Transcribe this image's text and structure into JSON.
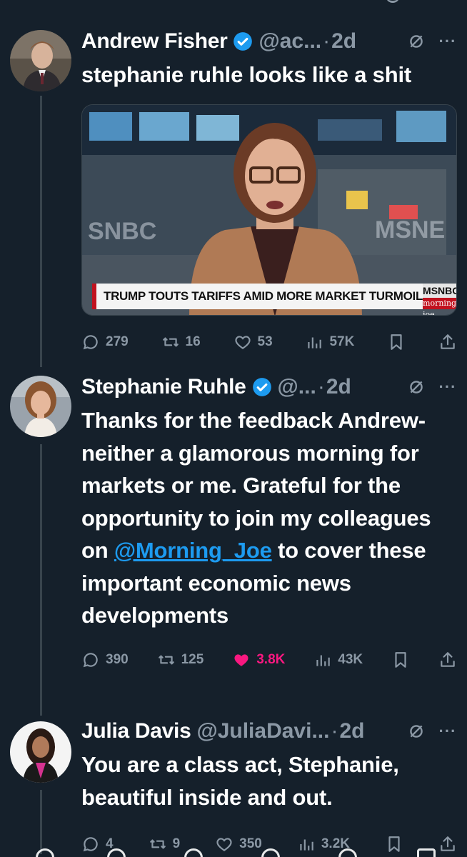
{
  "tweets": [
    {
      "name": "Andrew Fisher",
      "handle": "@ac...",
      "time": "2d",
      "text": "stephanie ruhle looks like a shit",
      "media": {
        "chyron": "TRUMP TOUTS TARIFFS AMID MORE MARKET TURMOIL",
        "brand": "MSNBC",
        "show": "morning joe",
        "wall_left": "SNBC",
        "wall_right": "MSNE"
      },
      "stats": {
        "replies": "279",
        "reposts": "16",
        "likes": "53",
        "views": "57K"
      }
    },
    {
      "name": "Stephanie Ruhle",
      "handle": "@...",
      "time": "2d",
      "text_before": "Thanks for the feedback Andrew- neither a glamorous morning for markets or me. Grateful for the opportunity to join my colleagues on ",
      "mention": "@Morning_Joe",
      "text_after": " to cover these important economic news developments",
      "stats": {
        "replies": "390",
        "reposts": "125",
        "likes": "3.8K",
        "views": "43K"
      }
    },
    {
      "name": "Julia Davis",
      "handle": "@JuliaDavi...",
      "time": "2d",
      "text": "You are a class act, Stephanie, beautiful inside and out.",
      "stats": {
        "replies": "4",
        "reposts": "9",
        "likes": "350",
        "views": "3.2K"
      }
    }
  ],
  "colors": {
    "background": "#15202b",
    "muted": "#8b98a5",
    "accent": "#1d9bf0",
    "like": "#f91880",
    "thread": "#38444d"
  },
  "icons": [
    "verified-badge-icon",
    "grok-icon",
    "more-icon",
    "reply-icon",
    "repost-icon",
    "like-icon",
    "views-icon",
    "bookmark-icon",
    "share-icon"
  ]
}
